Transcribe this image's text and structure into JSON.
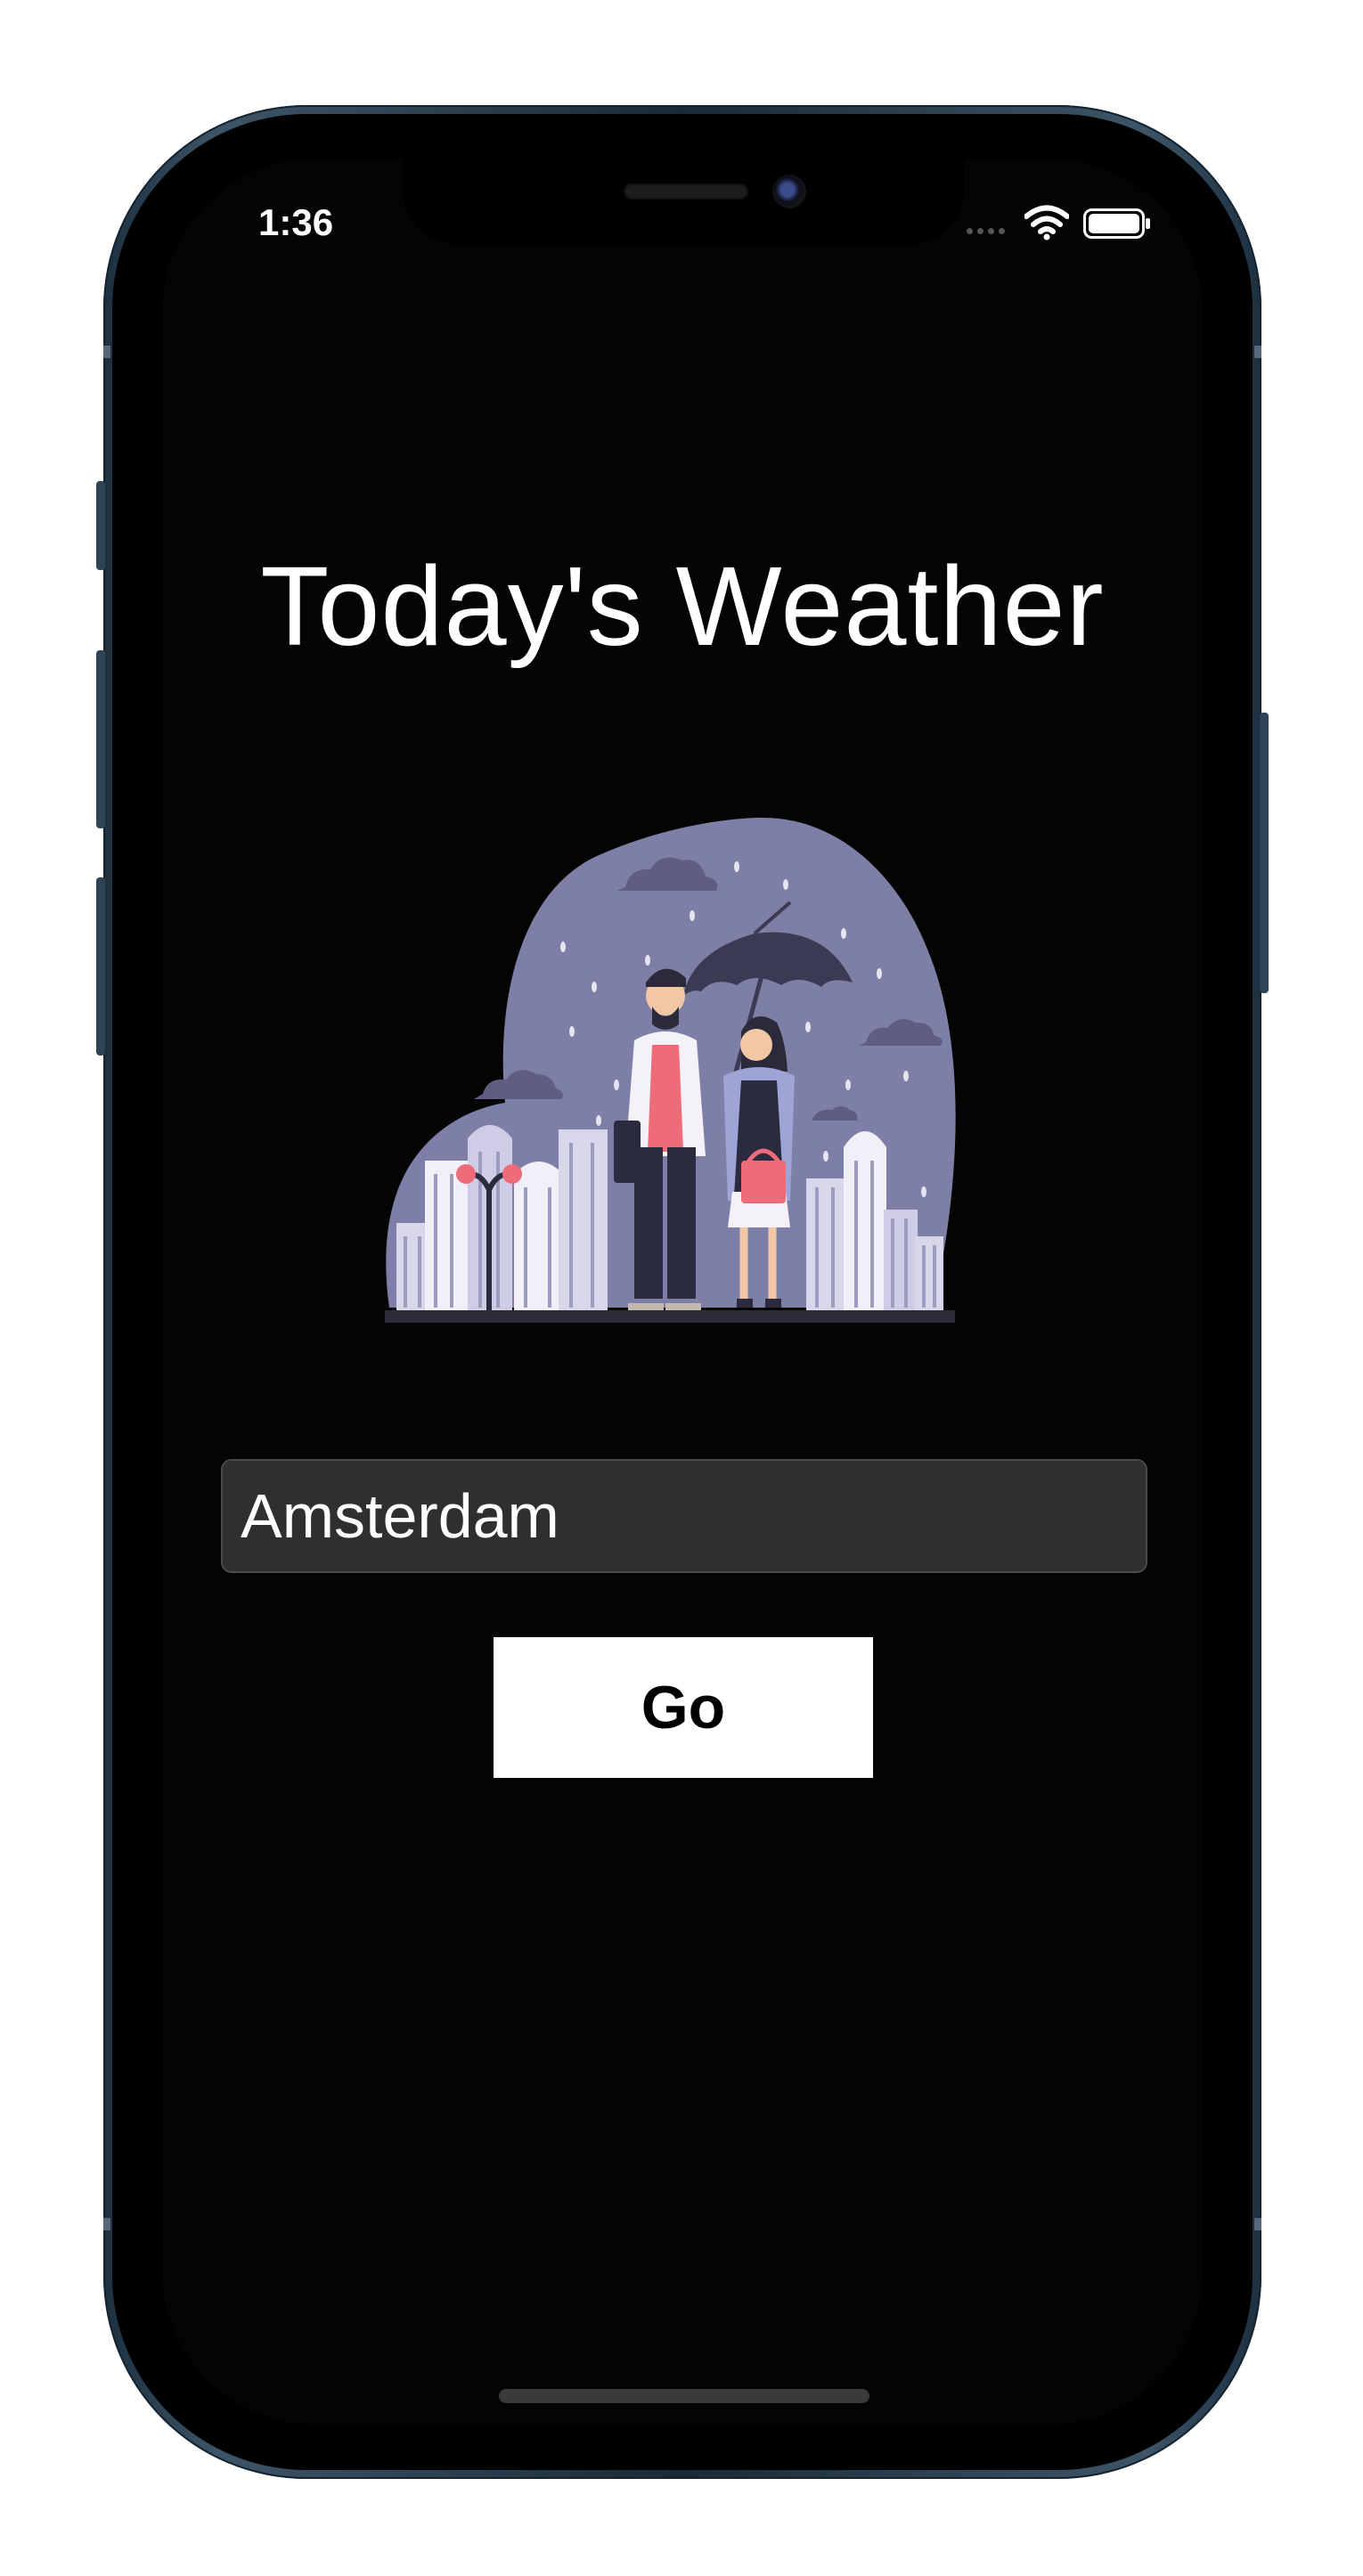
{
  "status_bar": {
    "time": "1:36"
  },
  "app": {
    "title": "Today's Weather",
    "search": {
      "value": "Amsterdam"
    },
    "go_button": {
      "label": "Go"
    }
  },
  "icons": [
    "wifi-icon",
    "battery-icon"
  ],
  "colors": {
    "screen_background": "#040404",
    "input_background": "#2f2f31",
    "button_background": "#ffffff",
    "illustration_blob": "#7e7fa6",
    "accent_pink": "#ee6b7a"
  }
}
